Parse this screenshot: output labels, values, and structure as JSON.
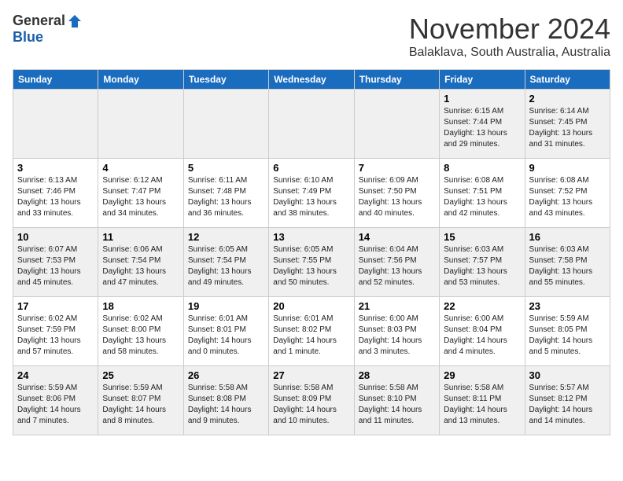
{
  "header": {
    "logo_general": "General",
    "logo_blue": "Blue",
    "month": "November 2024",
    "location": "Balaklava, South Australia, Australia"
  },
  "weekdays": [
    "Sunday",
    "Monday",
    "Tuesday",
    "Wednesday",
    "Thursday",
    "Friday",
    "Saturday"
  ],
  "weeks": [
    [
      {
        "day": "",
        "text": ""
      },
      {
        "day": "",
        "text": ""
      },
      {
        "day": "",
        "text": ""
      },
      {
        "day": "",
        "text": ""
      },
      {
        "day": "",
        "text": ""
      },
      {
        "day": "1",
        "text": "Sunrise: 6:15 AM\nSunset: 7:44 PM\nDaylight: 13 hours\nand 29 minutes."
      },
      {
        "day": "2",
        "text": "Sunrise: 6:14 AM\nSunset: 7:45 PM\nDaylight: 13 hours\nand 31 minutes."
      }
    ],
    [
      {
        "day": "3",
        "text": "Sunrise: 6:13 AM\nSunset: 7:46 PM\nDaylight: 13 hours\nand 33 minutes."
      },
      {
        "day": "4",
        "text": "Sunrise: 6:12 AM\nSunset: 7:47 PM\nDaylight: 13 hours\nand 34 minutes."
      },
      {
        "day": "5",
        "text": "Sunrise: 6:11 AM\nSunset: 7:48 PM\nDaylight: 13 hours\nand 36 minutes."
      },
      {
        "day": "6",
        "text": "Sunrise: 6:10 AM\nSunset: 7:49 PM\nDaylight: 13 hours\nand 38 minutes."
      },
      {
        "day": "7",
        "text": "Sunrise: 6:09 AM\nSunset: 7:50 PM\nDaylight: 13 hours\nand 40 minutes."
      },
      {
        "day": "8",
        "text": "Sunrise: 6:08 AM\nSunset: 7:51 PM\nDaylight: 13 hours\nand 42 minutes."
      },
      {
        "day": "9",
        "text": "Sunrise: 6:08 AM\nSunset: 7:52 PM\nDaylight: 13 hours\nand 43 minutes."
      }
    ],
    [
      {
        "day": "10",
        "text": "Sunrise: 6:07 AM\nSunset: 7:53 PM\nDaylight: 13 hours\nand 45 minutes."
      },
      {
        "day": "11",
        "text": "Sunrise: 6:06 AM\nSunset: 7:54 PM\nDaylight: 13 hours\nand 47 minutes."
      },
      {
        "day": "12",
        "text": "Sunrise: 6:05 AM\nSunset: 7:54 PM\nDaylight: 13 hours\nand 49 minutes."
      },
      {
        "day": "13",
        "text": "Sunrise: 6:05 AM\nSunset: 7:55 PM\nDaylight: 13 hours\nand 50 minutes."
      },
      {
        "day": "14",
        "text": "Sunrise: 6:04 AM\nSunset: 7:56 PM\nDaylight: 13 hours\nand 52 minutes."
      },
      {
        "day": "15",
        "text": "Sunrise: 6:03 AM\nSunset: 7:57 PM\nDaylight: 13 hours\nand 53 minutes."
      },
      {
        "day": "16",
        "text": "Sunrise: 6:03 AM\nSunset: 7:58 PM\nDaylight: 13 hours\nand 55 minutes."
      }
    ],
    [
      {
        "day": "17",
        "text": "Sunrise: 6:02 AM\nSunset: 7:59 PM\nDaylight: 13 hours\nand 57 minutes."
      },
      {
        "day": "18",
        "text": "Sunrise: 6:02 AM\nSunset: 8:00 PM\nDaylight: 13 hours\nand 58 minutes."
      },
      {
        "day": "19",
        "text": "Sunrise: 6:01 AM\nSunset: 8:01 PM\nDaylight: 14 hours\nand 0 minutes."
      },
      {
        "day": "20",
        "text": "Sunrise: 6:01 AM\nSunset: 8:02 PM\nDaylight: 14 hours\nand 1 minute."
      },
      {
        "day": "21",
        "text": "Sunrise: 6:00 AM\nSunset: 8:03 PM\nDaylight: 14 hours\nand 3 minutes."
      },
      {
        "day": "22",
        "text": "Sunrise: 6:00 AM\nSunset: 8:04 PM\nDaylight: 14 hours\nand 4 minutes."
      },
      {
        "day": "23",
        "text": "Sunrise: 5:59 AM\nSunset: 8:05 PM\nDaylight: 14 hours\nand 5 minutes."
      }
    ],
    [
      {
        "day": "24",
        "text": "Sunrise: 5:59 AM\nSunset: 8:06 PM\nDaylight: 14 hours\nand 7 minutes."
      },
      {
        "day": "25",
        "text": "Sunrise: 5:59 AM\nSunset: 8:07 PM\nDaylight: 14 hours\nand 8 minutes."
      },
      {
        "day": "26",
        "text": "Sunrise: 5:58 AM\nSunset: 8:08 PM\nDaylight: 14 hours\nand 9 minutes."
      },
      {
        "day": "27",
        "text": "Sunrise: 5:58 AM\nSunset: 8:09 PM\nDaylight: 14 hours\nand 10 minutes."
      },
      {
        "day": "28",
        "text": "Sunrise: 5:58 AM\nSunset: 8:10 PM\nDaylight: 14 hours\nand 11 minutes."
      },
      {
        "day": "29",
        "text": "Sunrise: 5:58 AM\nSunset: 8:11 PM\nDaylight: 14 hours\nand 13 minutes."
      },
      {
        "day": "30",
        "text": "Sunrise: 5:57 AM\nSunset: 8:12 PM\nDaylight: 14 hours\nand 14 minutes."
      }
    ]
  ]
}
